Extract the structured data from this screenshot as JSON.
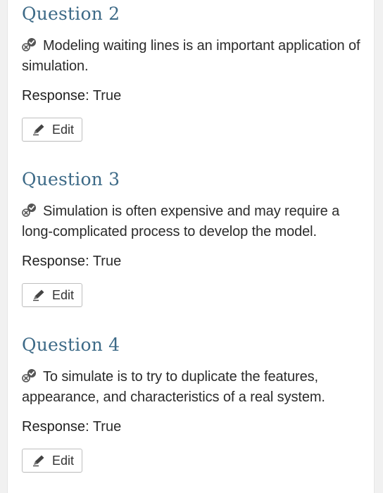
{
  "questions": [
    {
      "title": "Question 2",
      "text": "Modeling waiting lines is an important application of simulation.",
      "response_label": "Response",
      "response_sep": ":",
      "response_value": "True",
      "edit_label": "Edit"
    },
    {
      "title": "Question 3",
      "text": "Simulation is often expensive and may require a long-complicated process to develop the model.",
      "response_label": "Response",
      "response_sep": ":",
      "response_value": "True",
      "edit_label": "Edit"
    },
    {
      "title": "Question 4",
      "text": "To simulate is to try to duplicate the features, appearance, and characteristics of a real system.",
      "response_label": "Response",
      "response_sep": ":",
      "response_value": "True",
      "edit_label": "Edit"
    }
  ],
  "colors": {
    "title": "#3d6a87",
    "text": "#2b2b2b",
    "background": "#f1f1f1",
    "card": "#ffffff"
  },
  "icons": {
    "status": "check-cross-status-icon",
    "edit": "pencil-icon"
  }
}
